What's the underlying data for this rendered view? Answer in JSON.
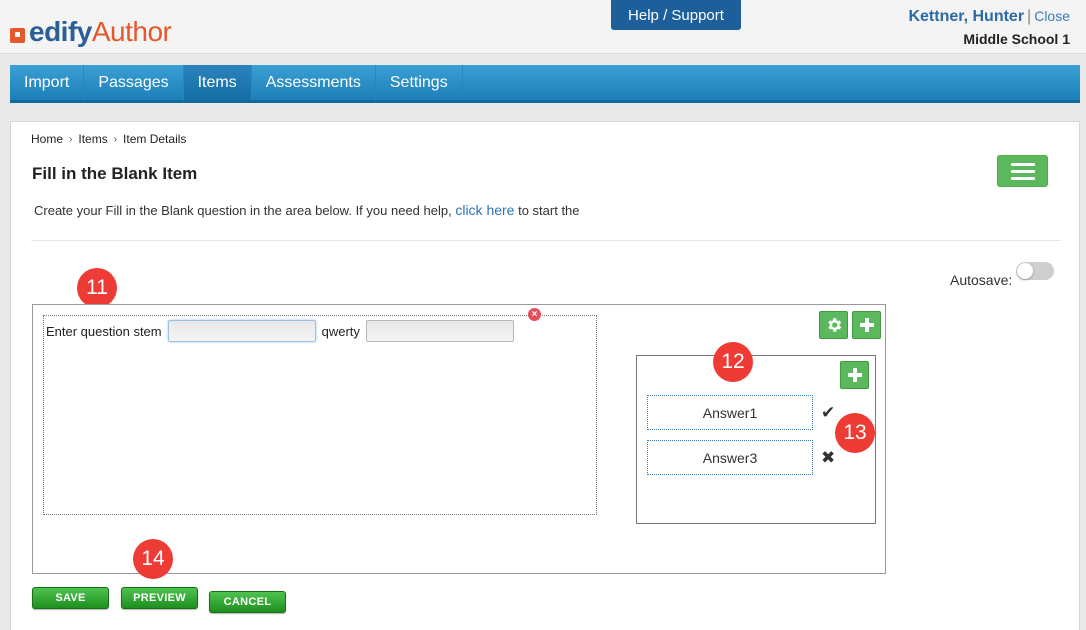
{
  "header": {
    "logo_edify": "edify",
    "logo_author": "Author",
    "help_label": "Help / Support",
    "user_name": "Kettner, Hunter",
    "close_label": "Close",
    "school": "Middle School 1"
  },
  "nav": {
    "items": [
      {
        "label": "Import"
      },
      {
        "label": "Passages"
      },
      {
        "label": "Items",
        "active": true
      },
      {
        "label": "Assessments"
      },
      {
        "label": "Settings"
      }
    ]
  },
  "breadcrumb": [
    "Home",
    "Items",
    "Item Details"
  ],
  "page": {
    "title": "Fill in the Blank Item",
    "instructions_before": "Create your Fill in the Blank question in the area below. If you need help,",
    "instructions_link": "click here",
    "instructions_after": "to start the",
    "autosave_label": "Autosave:"
  },
  "editor": {
    "stem_text": "Enter question stem",
    "blank1_value": "",
    "middle_text": "qwerty",
    "blank2_value": "",
    "answers": [
      {
        "value": "Answer1",
        "status": "correct",
        "icon": "check-icon"
      },
      {
        "value": "Answer3",
        "status": "incorrect",
        "icon": "times-icon"
      }
    ]
  },
  "markers": [
    "11",
    "12",
    "13",
    "14"
  ],
  "buttons": {
    "save": "SAVE",
    "preview": "PREVIEW",
    "cancel": "CANCEL"
  },
  "colors": {
    "brand_blue": "#2a5f96",
    "brand_orange": "#e4582b",
    "nav_blue": "#1d7fb8",
    "green": "#5cb85c",
    "marker_red": "#ee3b36"
  }
}
